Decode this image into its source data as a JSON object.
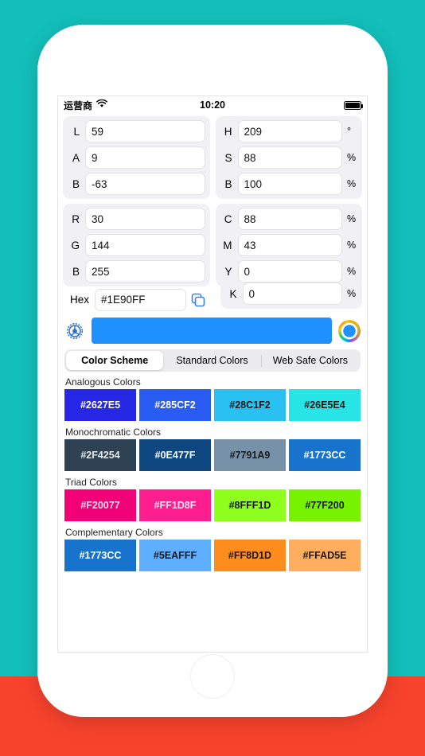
{
  "statusbar": {
    "carrier": "运营商",
    "wifi_icon": "wifi-icon",
    "time": "10:20",
    "battery_icon": "battery-icon"
  },
  "color": {
    "hex_value": "#1E90FF",
    "preview_color": "#1E90FF"
  },
  "fields": {
    "lab": [
      {
        "label": "L",
        "value": "59",
        "unit": ""
      },
      {
        "label": "A",
        "value": "9",
        "unit": ""
      },
      {
        "label": "B",
        "value": "-63",
        "unit": ""
      }
    ],
    "hsb": [
      {
        "label": "H",
        "value": "209",
        "unit": "°"
      },
      {
        "label": "S",
        "value": "88",
        "unit": "%"
      },
      {
        "label": "B",
        "value": "100",
        "unit": "%"
      }
    ],
    "rgb": [
      {
        "label": "R",
        "value": "30",
        "unit": ""
      },
      {
        "label": "G",
        "value": "144",
        "unit": ""
      },
      {
        "label": "B",
        "value": "255",
        "unit": ""
      }
    ],
    "cmyk": [
      {
        "label": "C",
        "value": "88",
        "unit": "%"
      },
      {
        "label": "M",
        "value": "43",
        "unit": "%"
      },
      {
        "label": "Y",
        "value": "0",
        "unit": "%"
      },
      {
        "label": "K",
        "value": "0",
        "unit": "%"
      }
    ],
    "hex": {
      "label": "Hex",
      "value": "#1E90FF",
      "copy_icon": "copy-icon"
    }
  },
  "toolbar": {
    "gear_icon": "gear-icon",
    "wheel_icon": "color-wheel-icon"
  },
  "tabs": [
    {
      "label": "Color Scheme",
      "active": true
    },
    {
      "label": "Standard Colors",
      "active": false
    },
    {
      "label": "Web Safe Colors",
      "active": false
    }
  ],
  "schemes": [
    {
      "title": "Analogous Colors",
      "swatches": [
        {
          "hex": "#2627E5",
          "text": "#FFFFFF"
        },
        {
          "hex": "#285CF2",
          "text": "#FFFFFF"
        },
        {
          "hex": "#28C1F2",
          "text": "#1A1A1A"
        },
        {
          "hex": "#26E5E4",
          "text": "#1A1A1A"
        }
      ]
    },
    {
      "title": "Monochromatic Colors",
      "swatches": [
        {
          "hex": "#2F4254",
          "text": "#E8E8E8"
        },
        {
          "hex": "#0E477F",
          "text": "#FFFFFF"
        },
        {
          "hex": "#7791A9",
          "text": "#1A1A1A"
        },
        {
          "hex": "#1773CC",
          "text": "#FFFFFF"
        }
      ]
    },
    {
      "title": "Triad Colors",
      "swatches": [
        {
          "hex": "#F20077",
          "text": "#FFD9EA"
        },
        {
          "hex": "#FF1D8F",
          "text": "#FFE0F0"
        },
        {
          "hex": "#8FFF1D",
          "text": "#1A1A1A"
        },
        {
          "hex": "#77F200",
          "text": "#1A1A1A"
        }
      ]
    },
    {
      "title": "Complementary Colors",
      "swatches": [
        {
          "hex": "#1773CC",
          "text": "#FFFFFF"
        },
        {
          "hex": "#5EAFFF",
          "text": "#1A1A1A"
        },
        {
          "hex": "#FF8D1D",
          "text": "#1A1A1A"
        },
        {
          "hex": "#FFAD5E",
          "text": "#1A1A1A"
        }
      ]
    }
  ],
  "background": {
    "top_color": "#13bfbb",
    "bottom_color": "#f8432c"
  }
}
